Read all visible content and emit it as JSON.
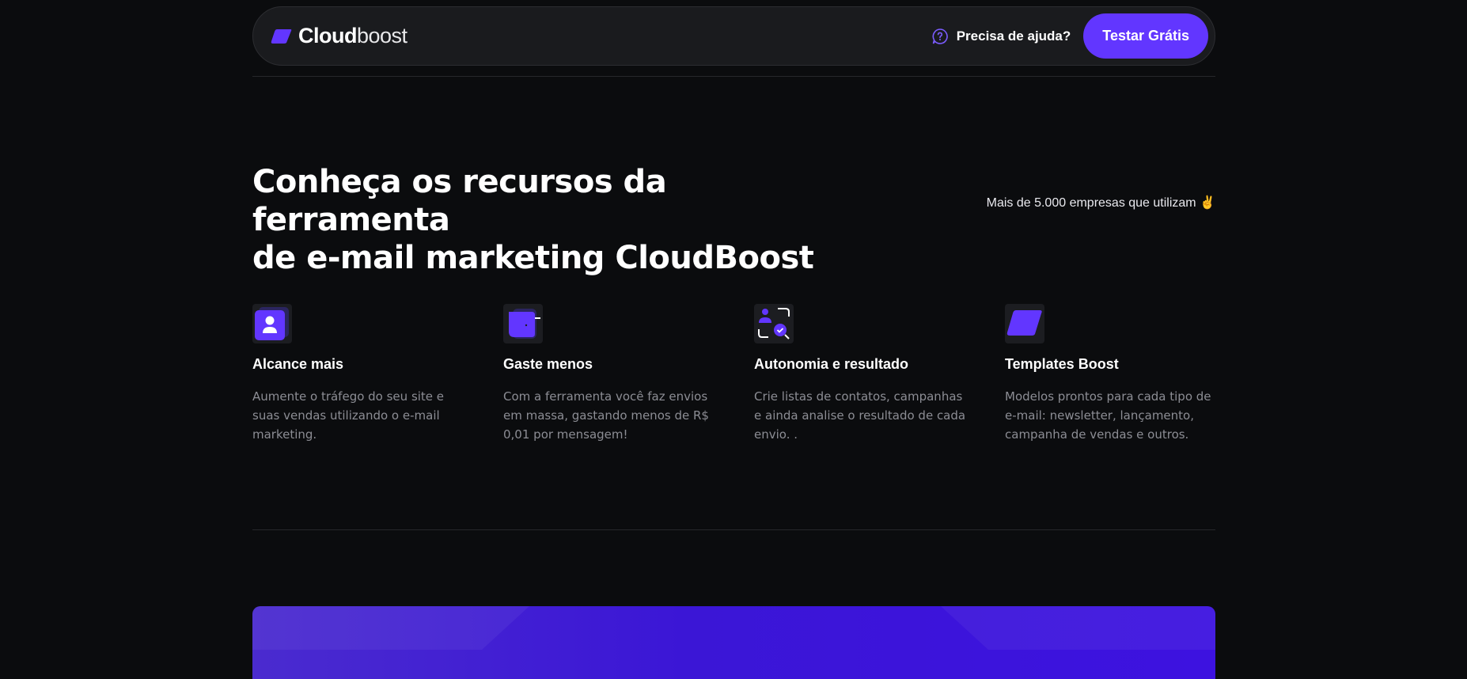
{
  "nav": {
    "logo_bold": "Cloud",
    "logo_light": "boost",
    "help_label": "Precisa de ajuda?",
    "cta_label": "Testar Grátis"
  },
  "hero": {
    "headline_line1": "Conheça os recursos da ferramenta",
    "headline_line2": "de e-mail marketing CloudBoost",
    "companies_text": "Mais de 5.000 empresas que utilizam ✌️"
  },
  "features": [
    {
      "icon": "user-card-icon",
      "title": "Alcance mais",
      "description": "Aumente o tráfego do seu site e suas vendas utilizando o e-mail marketing."
    },
    {
      "icon": "wallet-icon",
      "title": "Gaste menos",
      "description": "Com a ferramenta você faz envios em massa, gastando menos de R$ 0,01 por mensagem!"
    },
    {
      "icon": "user-search-icon",
      "title": "Autonomia e resultado",
      "description": "Crie listas de contatos, campanhas e ainda analise o resultado de cada envio. ."
    },
    {
      "icon": "template-tag-icon",
      "title": "Templates Boost",
      "description": "Modelos prontos para cada tipo de e-mail: newsletter, lançamento, campanha de vendas e outros."
    }
  ],
  "colors": {
    "accent": "#6236ff",
    "background": "#0b0c0e",
    "nav_bg": "#1a1b1e",
    "muted_text": "#8c8d94",
    "banner": "#3d12e0"
  }
}
